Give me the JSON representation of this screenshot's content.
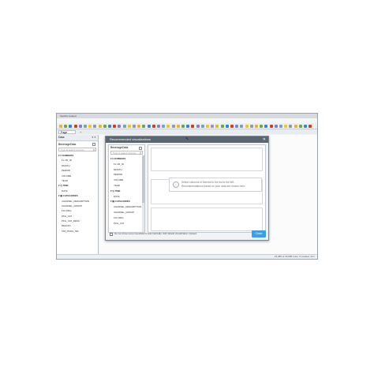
{
  "window": {
    "title": "Spotfire Analyst"
  },
  "menubar": {
    "items": [
      "File",
      "Edit",
      "View",
      "Insert",
      "Tools",
      "Help"
    ]
  },
  "pagetabs": {
    "tabs": [
      {
        "label": "Page"
      }
    ],
    "add_label": "+"
  },
  "datapanel": {
    "title": "Data",
    "controls": "▾ ✕",
    "source": "BeverageData",
    "search_placeholder": "Type to search columns",
    "tree": [
      {
        "kind": "group",
        "label": "▾ # NUMBERS"
      },
      {
        "kind": "item",
        "label": "FL-VR_ID"
      },
      {
        "kind": "item",
        "label": "MONTH"
      },
      {
        "kind": "item",
        "label": "PERIOD"
      },
      {
        "kind": "item",
        "label": "VOLUME"
      },
      {
        "kind": "item",
        "label": "YEAR"
      },
      {
        "kind": "group",
        "label": "▾ ◷ TIME"
      },
      {
        "kind": "item",
        "label": "DATE"
      },
      {
        "kind": "group",
        "label": "▾ ▤ CATEGORIES"
      },
      {
        "kind": "item",
        "label": "CHANNEL_DESCRIPTION"
      },
      {
        "kind": "item",
        "label": "CHANNEL_GROUP"
      },
      {
        "kind": "item",
        "label": "FLV-ORG"
      },
      {
        "kind": "item",
        "label": "PKG_CAT"
      },
      {
        "kind": "item",
        "label": "PKG_CAT_DESC"
      },
      {
        "kind": "item",
        "label": "REGION"
      },
      {
        "kind": "item",
        "label": "TAR_PKNG_NM"
      }
    ]
  },
  "dialog": {
    "title": "Recommended visualizations",
    "close": "✕",
    "source": "BeverageData",
    "search_placeholder": "Type to search columns",
    "tree": [
      {
        "kind": "group",
        "label": "▾ # NUMBERS"
      },
      {
        "kind": "item",
        "label": "FL-VR_ID"
      },
      {
        "kind": "item",
        "label": "MONTH"
      },
      {
        "kind": "item",
        "label": "PERIOD"
      },
      {
        "kind": "item",
        "label": "VOLUME"
      },
      {
        "kind": "item",
        "label": "YEAR"
      },
      {
        "kind": "group",
        "label": "▾ ◷ TIME"
      },
      {
        "kind": "item",
        "label": "DATE"
      },
      {
        "kind": "group",
        "label": "▾ ▤ CATEGORIES"
      },
      {
        "kind": "item",
        "label": "CHANNEL_DESCRIPTION"
      },
      {
        "kind": "item",
        "label": "CHANNEL_GROUP"
      },
      {
        "kind": "item",
        "label": "FLV-ORG"
      },
      {
        "kind": "item",
        "label": "PKG_CAT"
      }
    ],
    "hint_line1": "Select columns of interest in the list to the left.",
    "hint_line2": "Recommendations based on your data are shown here.",
    "checkbox_label": "Do not show recommendations automatically. Add default visualization instead.",
    "close_button": "Close"
  },
  "statusbar": {
    "text": "15,085 of 15,085 rows, 0 marked, 12 c"
  },
  "colors": {
    "accent": "#3fa0df",
    "dialog_title": "#5c6670"
  }
}
